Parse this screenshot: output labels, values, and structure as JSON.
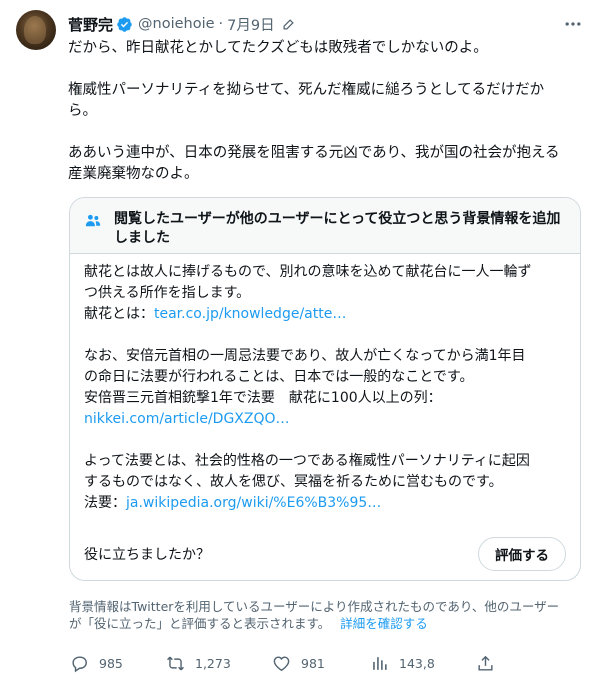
{
  "colors": {
    "link": "#1d9bf0",
    "verified": "#1d9bf0",
    "muted": "#536471",
    "text": "#0f1419",
    "border": "#cfd9de"
  },
  "header": {
    "name": "菅野完",
    "handle": "@noiehoie",
    "separator": "·",
    "date": "7月9日",
    "edit_icon": "pencil-edit-icon",
    "more_icon": "more-icon",
    "verified_icon": "verified-badge-icon"
  },
  "tweet": {
    "paragraphs": [
      "だから、昨日献花とかしてたクズどもは敗残者でしかないのよ。",
      "権威性パーソナリティを拗らせて、死んだ権威に縋ろうとしてるだけだか\nら。",
      "ああいう連中が、日本の発展を阻害する元凶であり、我が国の社会が抱える\n産業廃棄物なのよ。"
    ]
  },
  "community_note": {
    "icon": "people-icon",
    "title_line1": "閲覧したユーザーが他のユーザーにとって役立つと思う背景情報を追加",
    "title_line2": "しました",
    "p1_line1": "献花とは故人に捧げるもので、別れの意味を込めて献花台に一人一輪ず",
    "p1_line2": "つ供える所作を指します。",
    "p1_label": "献花とは：",
    "p1_link": "tear.co.jp/knowledge/atte…",
    "p2_line1": "なお、安倍元首相の一周忌法要であり、故人が亡くなってから満1年目",
    "p2_line2": "の命日に法要が行われることは、日本では一般的なことです。",
    "p2_line3": "安倍晋三元首相銃撃1年で法要　献花に100人以上の列：",
    "p2_link": "nikkei.com/article/DGXZQO…",
    "p3_line1": "よって法要とは、社会的性格の一つである権威性パーソナリティに起因",
    "p3_line2": "するものではなく、故人を偲び、冥福を祈るために営むものです。",
    "p3_label": "法要：",
    "p3_link": "ja.wikipedia.org/wiki/%E6%B3%95…",
    "helpful_question": "役に立ちましたか？",
    "rate_button": "評価する"
  },
  "footnote": {
    "text_line1": "背景情報はTwitterを利用しているユーザーにより作成されたものであり、他のユーザー",
    "text_line2": "が「役に立った」と評価すると表示されます。",
    "link": "詳細を確認する"
  },
  "actions": {
    "reply_count": "985",
    "retweet_count": "1,273",
    "like_count": "981",
    "views_count": "143,8",
    "icons": [
      "reply-icon",
      "retweet-icon",
      "like-icon",
      "views-icon",
      "share-icon"
    ]
  }
}
